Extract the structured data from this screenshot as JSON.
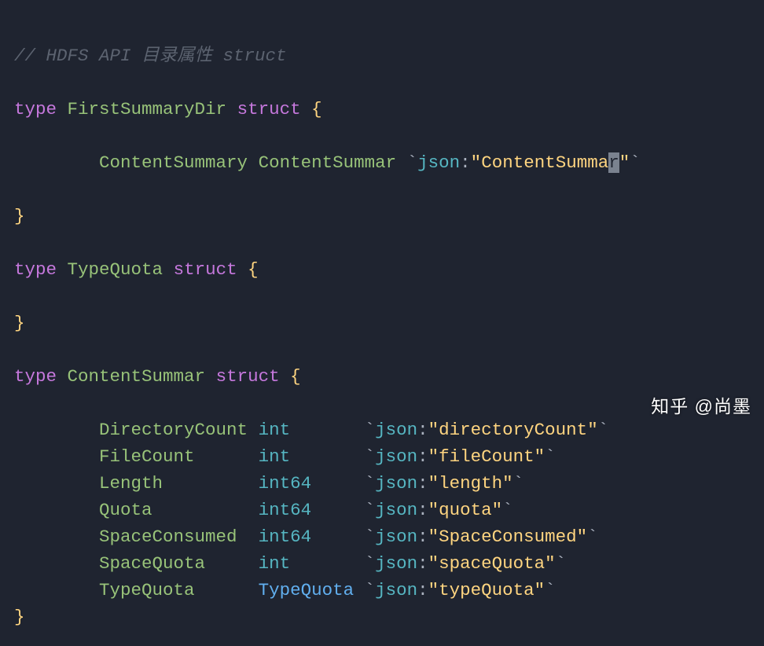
{
  "code": {
    "line1": {
      "comment": "// HDFS API 目录属性 struct"
    },
    "line2": {
      "kw1": "type",
      "name": "FirstSummaryDir",
      "kw2": "struct",
      "brace": "{"
    },
    "line3": {
      "indent": "        ",
      "field": "ContentSummary",
      "ftype": "ContentSummar",
      "tag_pre": "`json:\"",
      "tag_val": "ContentSumma",
      "tag_cursor": "r",
      "tag_post": "\"`"
    },
    "line4": {
      "brace": "}"
    },
    "line5": {
      "kw1": "type",
      "name": "TypeQuota",
      "kw2": "struct",
      "brace": "{"
    },
    "line6": {
      "brace": "}"
    },
    "line7": {
      "kw1": "type",
      "name": "ContentSummar",
      "kw2": "struct",
      "brace": "{"
    },
    "fields": [
      {
        "name": "DirectoryCount",
        "type": "int",
        "pad1": "        ",
        "pad2": " ",
        "json": "directoryCount"
      },
      {
        "name": "FileCount",
        "type": "int",
        "pad1": "        ",
        "pad2": "      ",
        "json": "fileCount"
      },
      {
        "name": "Length",
        "type": "int64",
        "pad1": "        ",
        "pad2": "         ",
        "json": "length"
      },
      {
        "name": "Quota",
        "type": "int64",
        "pad1": "        ",
        "pad2": "          ",
        "json": "quota"
      },
      {
        "name": "SpaceConsumed",
        "type": "int64",
        "pad1": "        ",
        "pad2": "  ",
        "json": "SpaceConsumed"
      },
      {
        "name": "SpaceQuota",
        "type": "int",
        "pad1": "        ",
        "pad2": "     ",
        "json": "spaceQuota"
      },
      {
        "name": "TypeQuota",
        "type": "TypeQuota",
        "pad1": "        ",
        "pad2": "      ",
        "json": "typeQuota"
      }
    ],
    "line_last": {
      "brace": "}"
    }
  },
  "watermark": "知乎 @尚墨"
}
